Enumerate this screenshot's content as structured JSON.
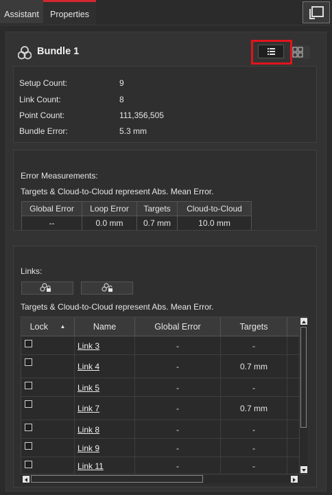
{
  "tabs": [
    {
      "label": "Assistant",
      "active": false
    },
    {
      "label": "Properties",
      "active": true
    }
  ],
  "bundle": {
    "title": "Bundle 1"
  },
  "view_toggle": {
    "selected": "list",
    "highlight_color": "#e0141c"
  },
  "info": [
    {
      "label": "Setup Count:",
      "value": "9"
    },
    {
      "label": "Link Count:",
      "value": "8"
    },
    {
      "label": "Point Count:",
      "value": "111,356,505"
    },
    {
      "label": "Bundle Error:",
      "value": "5.3 mm"
    }
  ],
  "error_section": {
    "heading": "Error Measurements:",
    "note": "Targets & Cloud-to-Cloud represent Abs. Mean Error.",
    "headers": [
      "Global Error",
      "Loop Error",
      "Targets",
      "Cloud-to-Cloud"
    ],
    "values": [
      "--",
      "0.0 mm",
      "0.7 mm",
      "10.0 mm"
    ]
  },
  "links_section": {
    "heading": "Links:",
    "note": "Targets & Cloud-to-Cloud represent Abs. Mean Error.",
    "headers": [
      "Lock",
      "Name",
      "Global Error",
      "Targets"
    ],
    "sort_indicator": "▲",
    "rows": [
      {
        "name": "Link 3",
        "global_error": "-",
        "targets": "-"
      },
      {
        "name": "Link 4",
        "global_error": "-",
        "targets": "0.7 mm"
      },
      {
        "name": "Link 5",
        "global_error": "-",
        "targets": "-"
      },
      {
        "name": "Link 7",
        "global_error": "-",
        "targets": "0.7 mm"
      },
      {
        "name": "Link 8",
        "global_error": "-",
        "targets": "-"
      },
      {
        "name": "Link 9",
        "global_error": "-",
        "targets": "-"
      },
      {
        "name": "Link 11",
        "global_error": "-",
        "targets": "-"
      }
    ]
  },
  "colors": {
    "accent_tab": "#d2262f",
    "background": "#2b2b2b"
  }
}
